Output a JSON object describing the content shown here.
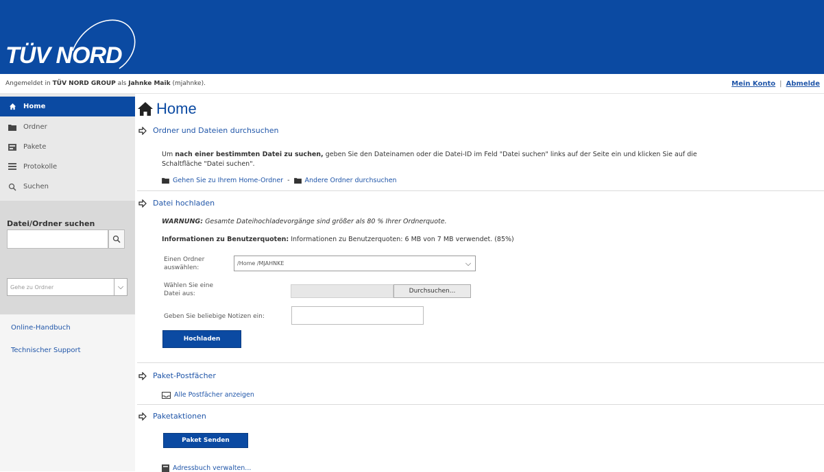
{
  "header": {
    "logo_text": "TÜV NORD",
    "bg_color": "#0b4aa2"
  },
  "login_bar": {
    "prefix": "Angemeldet in",
    "org": "TÜV NORD GROUP",
    "as": "als",
    "user": "Jahnke Maik",
    "userid": "(mjahnke).",
    "my_account": "Mein Konto",
    "separator": "|",
    "logout": "Abmelde"
  },
  "sidebar": {
    "items": [
      {
        "label": "Home",
        "icon": "home-icon"
      },
      {
        "label": "Ordner",
        "icon": "folder-icon"
      },
      {
        "label": "Pakete",
        "icon": "package-icon"
      },
      {
        "label": "Protokolle",
        "icon": "list-icon"
      },
      {
        "label": "Suchen",
        "icon": "search-icon"
      }
    ],
    "search_label": "Datei/Ordner suchen",
    "search_value": "",
    "goto_placeholder": "Gehe zu Ordner",
    "links": [
      "Online-Handbuch",
      "Technischer Support"
    ]
  },
  "main": {
    "title": "Home",
    "sections": {
      "browse": {
        "heading": "Ordner und Dateien durchsuchen",
        "text_pre": "Um",
        "text_bold": "nach einer bestimmten Datei zu suchen,",
        "text_post": "geben Sie den Dateinamen oder die Datei-ID im Feld \"Datei suchen\" links auf der Seite ein und klicken Sie auf die",
        "text_line2": "Schaltfläche \"Datei suchen\".",
        "link_home": "Gehen Sie zu Ihrem Home-Ordner",
        "link_sep": "-",
        "link_other": "Andere Ordner durchsuchen"
      },
      "upload": {
        "heading": "Datei hochladen",
        "warning_bold": "WARNUNG:",
        "warning_text": "Gesamte Dateihochladevorgänge sind größer als 80 % Ihrer Ordnerquote.",
        "quota_bold": "Informationen zu Benutzerquoten:",
        "quota_text": "Informationen zu Benutzerquoten: 6 MB von 7 MB verwendet. (85%)",
        "folder_label_1": "Einen Ordner",
        "folder_label_2": "auswählen:",
        "folder_value": "/Home /MJAHNKE",
        "file_label_1": "Wählen Sie eine",
        "file_label_2": "Datei aus:",
        "browse_label": "Durchsuchen...",
        "notes_label": "Geben Sie beliebige Notizen ein:",
        "submit_label": "Hochladen"
      },
      "mailboxes": {
        "heading": "Paket-Postfächer",
        "link": "Alle Postfächer anzeigen"
      },
      "actions": {
        "heading": "Paketaktionen",
        "send_label": "Paket Senden",
        "addressbook_link": "Adressbuch verwalten..."
      }
    }
  }
}
